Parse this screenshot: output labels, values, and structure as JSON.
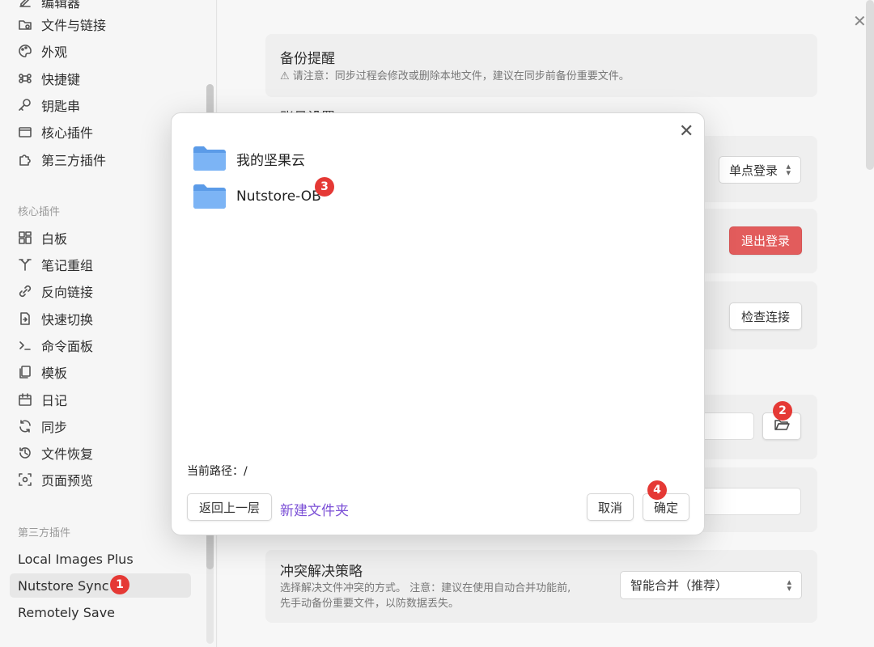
{
  "sidebar": {
    "options_items": [
      {
        "label": "编辑器",
        "icon": "edit-icon"
      },
      {
        "label": "文件与链接",
        "icon": "folder-link-icon"
      },
      {
        "label": "外观",
        "icon": "palette-icon"
      },
      {
        "label": "快捷键",
        "icon": "command-icon"
      },
      {
        "label": "钥匙串",
        "icon": "key-icon"
      },
      {
        "label": "核心插件",
        "icon": "plugin-icon"
      },
      {
        "label": "第三方插件",
        "icon": "puzzle-icon"
      }
    ],
    "core_header": "核心插件",
    "core_items": [
      {
        "label": "白板",
        "icon": "canvas-icon"
      },
      {
        "label": "笔记重组",
        "icon": "merge-icon"
      },
      {
        "label": "反向链接",
        "icon": "backlink-icon"
      },
      {
        "label": "快速切换",
        "icon": "file-switch-icon"
      },
      {
        "label": "命令面板",
        "icon": "terminal-icon"
      },
      {
        "label": "模板",
        "icon": "template-icon"
      },
      {
        "label": "日记",
        "icon": "calendar-icon"
      },
      {
        "label": "同步",
        "icon": "sync-icon"
      },
      {
        "label": "文件恢复",
        "icon": "history-icon"
      },
      {
        "label": "页面预览",
        "icon": "preview-icon"
      }
    ],
    "thirdparty_header": "第三方插件",
    "thirdparty_items": [
      {
        "label": "Local Images Plus"
      },
      {
        "label": "Nutstore Sync"
      },
      {
        "label": "Remotely Save"
      }
    ]
  },
  "settings": {
    "backup_title": "备份提醒",
    "backup_desc": "⚠ 请注意：同步过程会修改或删除本地文件，建议在同步前备份重要文件。",
    "account_title": "账号设置",
    "login_select": "单点登录",
    "logout_button": "退出登录",
    "check_button": "检查连接",
    "conflict_title": "冲突解决策略",
    "conflict_desc_1": "选择解决文件冲突的方式。 注意：建议在使用自动合并功能前,",
    "conflict_desc_2": "先手动备份重要文件，以防数据丢失。",
    "conflict_select": "智能合并（推荐）"
  },
  "modal": {
    "folders": [
      {
        "name": "我的坚果云"
      },
      {
        "name": "Nutstore-OB"
      }
    ],
    "path_label": "当前路径：/",
    "back_button": "返回上一层",
    "new_folder_link": "新建文件夹",
    "cancel_button": "取消",
    "confirm_button": "确定"
  },
  "badges": [
    "1",
    "2",
    "3",
    "4"
  ],
  "colors": {
    "accent_link": "#7b4fd6",
    "danger": "#e25c5c",
    "badge": "#e53935",
    "folder": "#6fa8f2"
  }
}
